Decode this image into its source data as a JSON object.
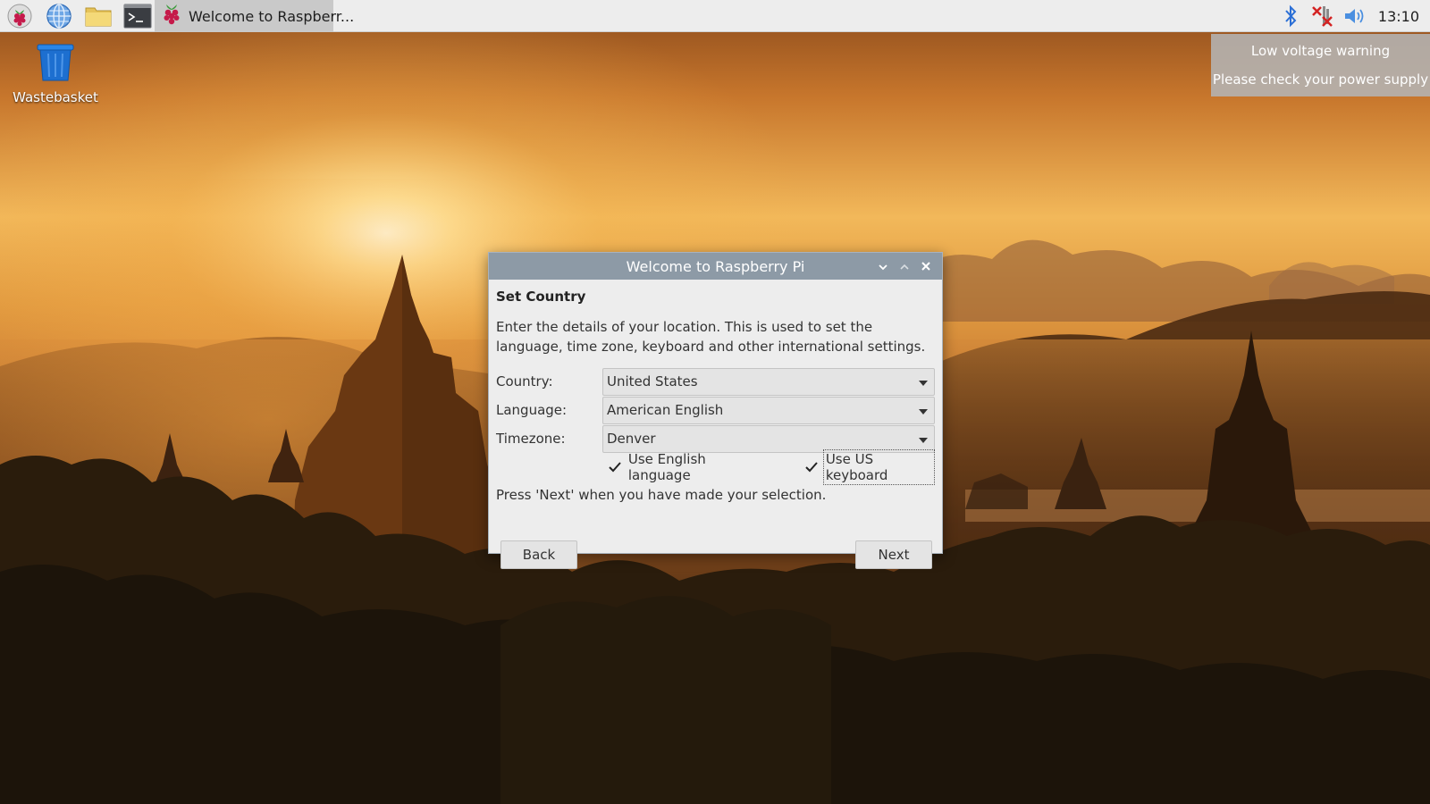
{
  "taskbar": {
    "launchers": [
      {
        "name": "raspberry-menu-icon"
      },
      {
        "name": "web-browser-icon"
      },
      {
        "name": "file-manager-icon"
      },
      {
        "name": "terminal-icon"
      }
    ],
    "active_task": {
      "label": "Welcome to Raspberr...",
      "icon": "raspberry-icon"
    },
    "tray": {
      "icons": [
        "bluetooth-icon",
        "network-disconnected-icon",
        "volume-icon"
      ],
      "clock": "13:10"
    }
  },
  "desktop": {
    "icons": [
      {
        "label": "Wastebasket",
        "icon": "wastebasket-icon"
      }
    ]
  },
  "notification": {
    "title": "Low voltage warning",
    "message": "Please check your power supply"
  },
  "dialog": {
    "title": "Welcome to Raspberry Pi",
    "heading": "Set Country",
    "description": "Enter the details of your location. This is used to set the language, time zone, keyboard and other international settings.",
    "fields": {
      "country": {
        "label": "Country:",
        "value": "United States"
      },
      "language": {
        "label": "Language:",
        "value": "American English"
      },
      "timezone": {
        "label": "Timezone:",
        "value": "Denver"
      }
    },
    "checkboxes": {
      "english": {
        "label": "Use English language",
        "checked": true
      },
      "us_keyboard": {
        "label": "Use US keyboard",
        "checked": true
      }
    },
    "instruction": "Press 'Next' when you have made your selection.",
    "buttons": {
      "back": "Back",
      "next": "Next"
    }
  },
  "colors": {
    "taskbar_bg": "#ededed",
    "dialog_titlebar": "#8d9aa6",
    "dialog_bg": "#ededed",
    "bluetooth_blue": "#2b6fd6",
    "network_error_red": "#d42222",
    "wastebasket_blue": "#1d6fd0"
  }
}
